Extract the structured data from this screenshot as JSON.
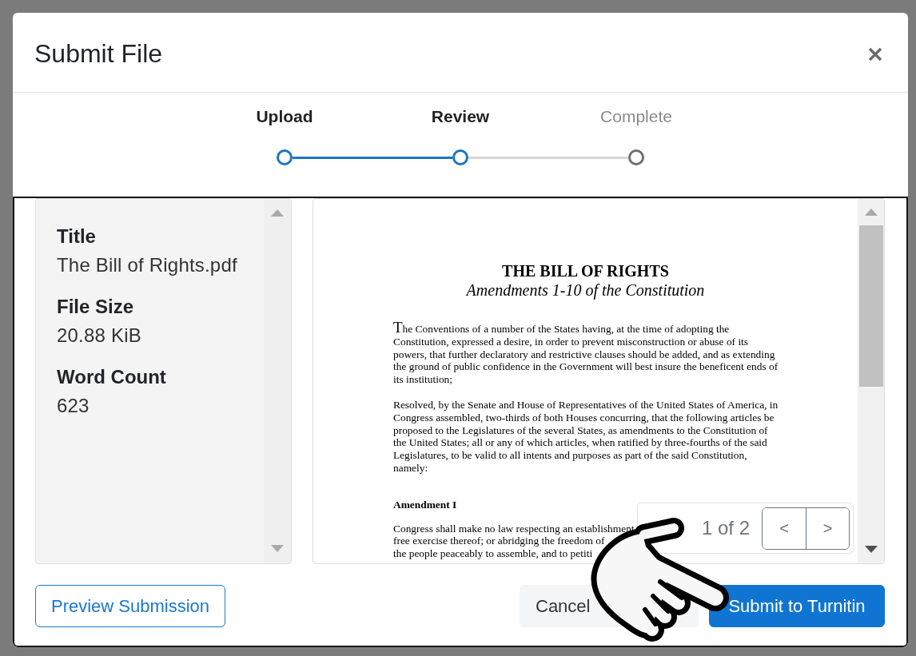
{
  "dialog": {
    "title": "Submit File"
  },
  "steps": [
    {
      "label": "Upload",
      "reached": true
    },
    {
      "label": "Review",
      "reached": true
    },
    {
      "label": "Complete",
      "reached": false
    }
  ],
  "details": [
    {
      "label": "Title",
      "value": "The Bill of Rights.pdf"
    },
    {
      "label": "File Size",
      "value": "20.88 KiB"
    },
    {
      "label": "Word Count",
      "value": "623"
    }
  ],
  "preview": {
    "document": {
      "title": "THE BILL OF RIGHTS",
      "subtitle": "Amendments 1-10 of the Constitution",
      "paragraphs": [
        "The Conventions of a number of the States having, at the time of adopting the Constitution, expressed a desire, in order to prevent misconstruction or abuse of its powers, that further declaratory and restrictive clauses should be added, and as extending the ground of public confidence in the Government will best insure the beneficent ends of its institution;",
        "Resolved, by the Senate and House of Representatives of the United States of America, in Congress assembled, two-thirds of both Houses concurring, that the following articles be proposed to the Legislatures of the several States, as amendments to the Constitution of the United States; all or any of which articles, when ratified by three-fourths of the said Legislatures, to be valid to all intents and purposes as part of the said Constitution, namely:"
      ],
      "section": {
        "heading": "Amendment I",
        "lines": [
          "Congress shall make no law respecting an establishment",
          "free exercise thereof; or abridging the freedom of",
          "the people peaceably to assemble, and to petiti"
        ]
      }
    },
    "pager": {
      "text": "1 of 2",
      "buttons": [
        "<",
        ">"
      ]
    }
  },
  "buttons": [
    {
      "label": "Preview Submission",
      "kind": "outline"
    },
    {
      "label": "Cancel",
      "kind": "secondary"
    },
    {
      "label": "Submit to Turnitin",
      "kind": "primary"
    }
  ]
}
